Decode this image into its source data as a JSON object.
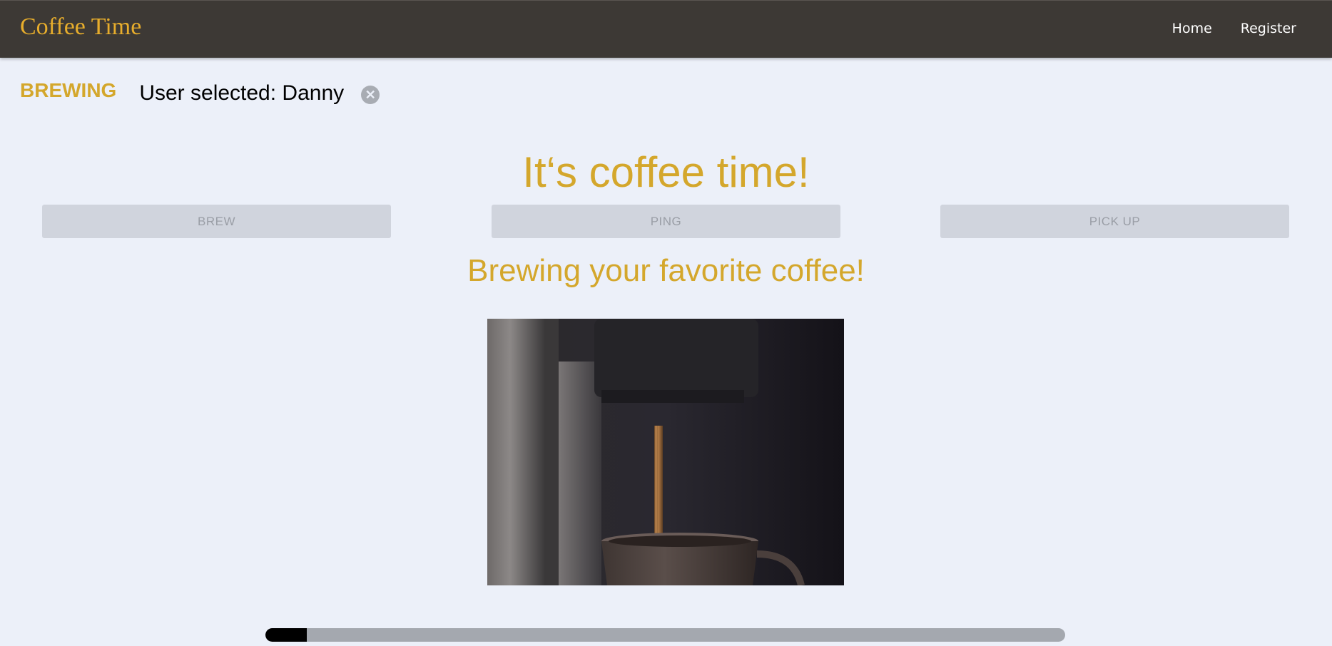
{
  "navbar": {
    "brand": "Coffee Time",
    "links": [
      {
        "label": "Home"
      },
      {
        "label": "Register"
      }
    ]
  },
  "status": {
    "label": "BREWING",
    "user_selected": "User selected: Danny",
    "clear_icon": "close-circle-icon"
  },
  "main": {
    "heading": "It‘s coffee time!",
    "buttons": {
      "brew": "BREW",
      "ping": "PING",
      "pickup": "PICK UP"
    },
    "subheading": "Brewing your favorite coffee!",
    "progress": 0.052
  },
  "colors": {
    "accent": "#d4a72c",
    "navbar": "#3d3935",
    "background": "#ecf0f9"
  }
}
